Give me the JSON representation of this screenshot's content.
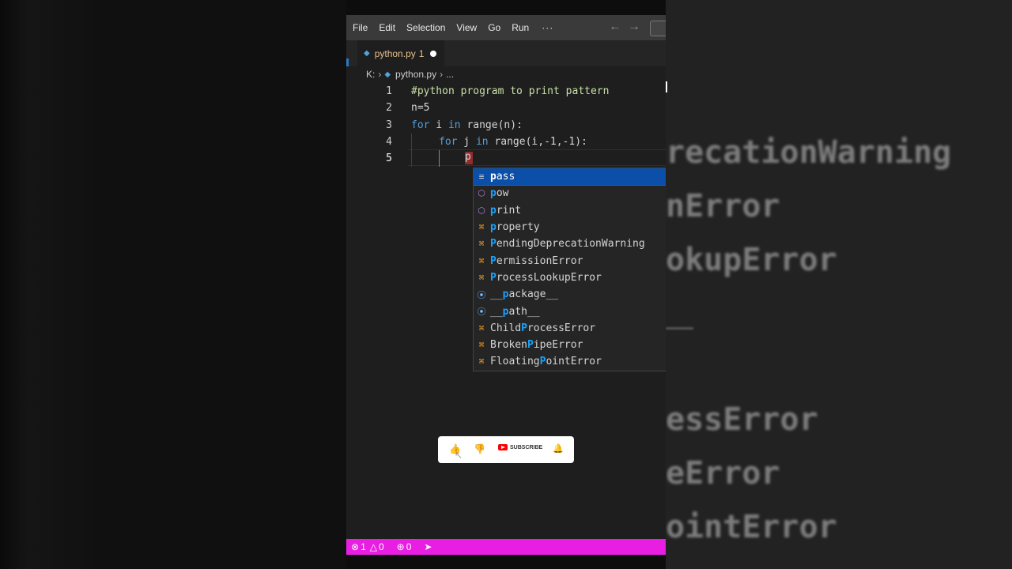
{
  "menubar": {
    "items": [
      "File",
      "Edit",
      "Selection",
      "View",
      "Go",
      "Run"
    ],
    "more": "···"
  },
  "tab": {
    "filename": "python.py",
    "problems": "1"
  },
  "breadcrumb": {
    "drive": "K:",
    "file": "python.py",
    "rest": "..."
  },
  "code": {
    "line_numbers": [
      "1",
      "2",
      "3",
      "4",
      "5"
    ],
    "line1": "#python program to print pattern",
    "line2": "n=5",
    "line3_kw1": "for",
    "line3_mid": " i ",
    "line3_kw2": "in",
    "line3_rest": " range(n):",
    "line4_kw1": "for",
    "line4_mid": " j ",
    "line4_kw2": "in",
    "line4_rest": " range(i,-1,-1):",
    "typed": "p"
  },
  "suggestions": [
    {
      "icon": "keyword-icon",
      "prefix": "p",
      "label": "ass",
      "pre": "",
      "kind": "kw"
    },
    {
      "icon": "cube-icon",
      "prefix": "p",
      "label": "ow",
      "pre": "",
      "kind": "fn"
    },
    {
      "icon": "cube-icon",
      "prefix": "p",
      "label": "rint",
      "pre": "",
      "kind": "fn"
    },
    {
      "icon": "class-icon",
      "prefix": "p",
      "label": "roperty",
      "pre": "",
      "kind": "cls"
    },
    {
      "icon": "class-icon",
      "prefix": "P",
      "label": "endingDeprecationWarning",
      "pre": "",
      "kind": "cls"
    },
    {
      "icon": "class-icon",
      "prefix": "P",
      "label": "ermissionError",
      "pre": "",
      "kind": "cls"
    },
    {
      "icon": "class-icon",
      "prefix": "P",
      "label": "rocessLookupError",
      "pre": "",
      "kind": "cls"
    },
    {
      "icon": "variable-icon",
      "prefix": "p",
      "label": "ackage__",
      "pre": "__",
      "kind": "var"
    },
    {
      "icon": "variable-icon",
      "prefix": "p",
      "label": "ath__",
      "pre": "__",
      "kind": "var"
    },
    {
      "icon": "class-icon",
      "prefix": "P",
      "label": "rocessError",
      "pre": "Child",
      "kind": "cls"
    },
    {
      "icon": "class-icon",
      "prefix": "P",
      "label": "ipeError",
      "pre": "Broken",
      "kind": "cls"
    },
    {
      "icon": "class-icon",
      "prefix": "P",
      "label": "ointError",
      "pre": "Floating",
      "kind": "cls"
    }
  ],
  "overlay": {
    "subscribe": "SUBSCRIBE"
  },
  "status": {
    "errors": "1",
    "warnings": "0",
    "ports": "0"
  },
  "background_words": [
    "recationWarning",
    "nError",
    "okupError",
    "essError",
    "eError",
    "ointError"
  ],
  "colors": {
    "status_bar": "#e81ee2",
    "selection": "#0b4fa8",
    "class_icon": "#ee9d28",
    "function_icon": "#b180d7"
  }
}
